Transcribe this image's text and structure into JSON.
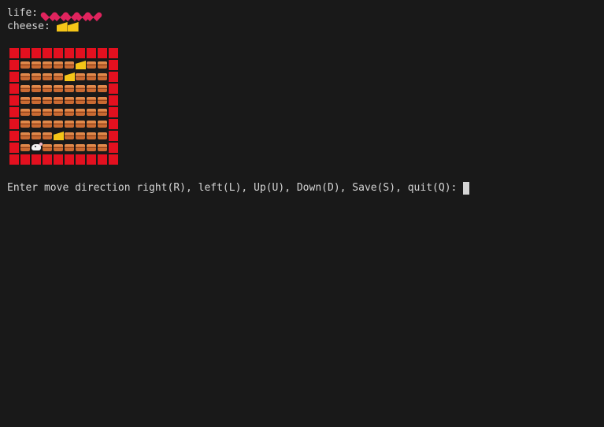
{
  "status": {
    "life_label": "life:",
    "life_count": 5,
    "life_icon": "sparkling-heart-icon",
    "cheese_label": "cheese:",
    "cheese_count": 2,
    "cheese_icon": "cheese-icon"
  },
  "board": {
    "legend": {
      "W": "wall",
      "B": "brick",
      "C": "cheese",
      "M": "mouse"
    },
    "rows": [
      "WWWWWWWWWW",
      "WBBBBBCBBW",
      "WBBBBCBBBW",
      "WBBBBBBBBW",
      "WBBBBBBBBW",
      "WBBBBBBBBW",
      "WBBBBBBBBW",
      "WBBBCBBBBW",
      "WBMBBBBBBW",
      "WWWWWWWWWW"
    ]
  },
  "prompt": {
    "text": "Enter move direction right(R), left(L), Up(U), Down(D), Save(S), quit(Q):"
  },
  "colors": {
    "background": "#191919",
    "text": "#d4d4d4",
    "wall": "#e3101f",
    "brick": "#c96a32",
    "cheese": "#f5c518",
    "heart": "#e0245e"
  }
}
